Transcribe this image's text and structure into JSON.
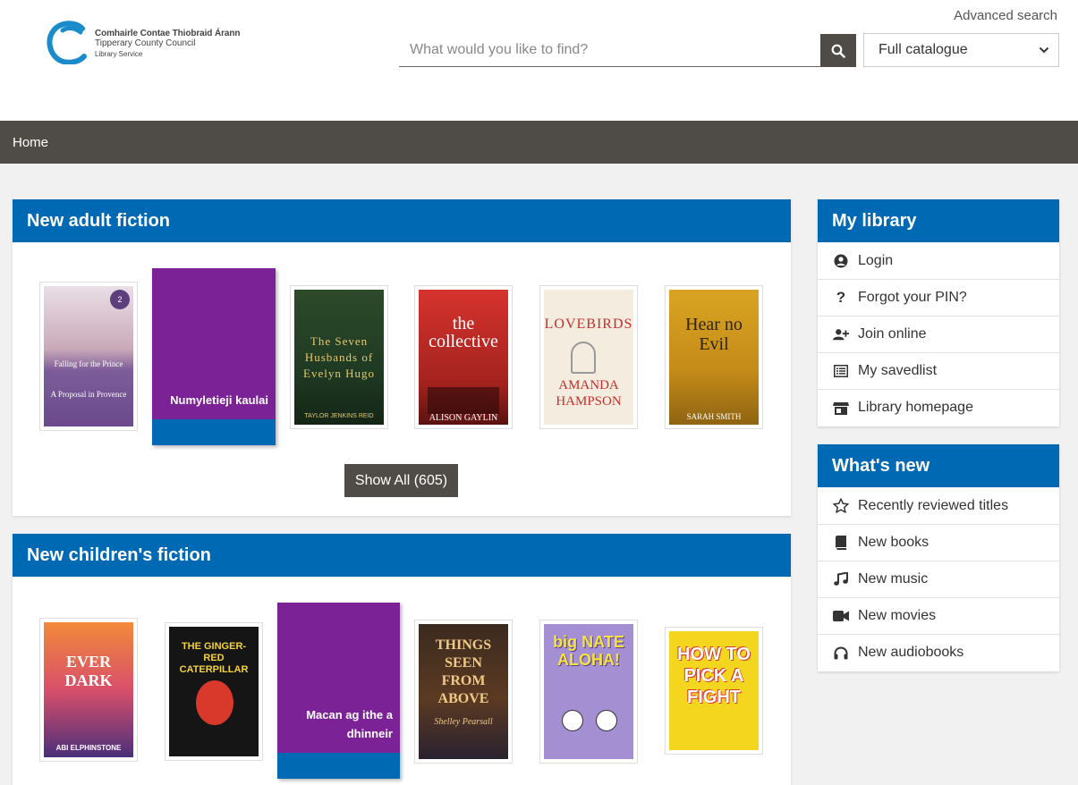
{
  "header": {
    "logo_line1": "Comhairle Contae Thiobraid Árann",
    "logo_line2": "Tipperary County Council",
    "logo_line3": "Library Service",
    "advanced_search": "Advanced search",
    "search_placeholder": "What would you like to find?",
    "catalogue_selected": "Full catalogue"
  },
  "nav": {
    "home": "Home"
  },
  "adult": {
    "title": "New adult fiction",
    "books": [
      {
        "cover_top": "Falling for the Prince",
        "cover_bottom": "A Proposal in Provence"
      },
      {
        "placeholder_title": "Numyletieji kaulai"
      },
      {
        "cover_top": "The Seven Husbands of Evelyn Hugo",
        "cover_bottom": "TAYLOR JENKINS REID"
      },
      {
        "cover_top": "the collective",
        "cover_bottom": "ALISON GAYLIN"
      },
      {
        "cover_top": "LOVEBIRDS",
        "cover_bottom": "AMANDA HAMPSON"
      },
      {
        "cover_top": "Hear no Evil",
        "cover_bottom": "SARAH SMITH"
      }
    ],
    "show_all": "Show All (605)"
  },
  "children": {
    "title": "New children's fiction",
    "books": [
      {
        "cover_top": "EVER DARK",
        "cover_bottom": "ABI ELPHINSTONE"
      },
      {
        "cover_top": "THE GINGER-RED CATERPILLAR",
        "cover_bottom": ""
      },
      {
        "placeholder_title": "Macan ag ithe a dhinneir"
      },
      {
        "cover_top": "THINGS SEEN FROM ABOVE",
        "cover_bottom": "Shelley Pearsall"
      },
      {
        "cover_top": "big NATE ALOHA!",
        "cover_bottom": ""
      },
      {
        "cover_top": "HOW TO PICK A FIGHT",
        "cover_bottom": ""
      }
    ]
  },
  "my_library": {
    "title": "My library",
    "items": [
      {
        "label": "Login",
        "icon": "user-circle-icon"
      },
      {
        "label": "Forgot your PIN?",
        "icon": "question-icon"
      },
      {
        "label": "Join online",
        "icon": "user-plus-icon"
      },
      {
        "label": "My savedlist",
        "icon": "list-icon"
      },
      {
        "label": "Library homepage",
        "icon": "store-icon"
      }
    ]
  },
  "whats_new": {
    "title": "What's new",
    "items": [
      {
        "label": "Recently reviewed titles",
        "icon": "star-icon"
      },
      {
        "label": "New books",
        "icon": "book-icon"
      },
      {
        "label": "New music",
        "icon": "music-icon"
      },
      {
        "label": "New movies",
        "icon": "video-icon"
      },
      {
        "label": "New audiobooks",
        "icon": "headphones-icon"
      }
    ]
  },
  "colors": {
    "brand_blue": "#0069b4",
    "dark_bar": "#4f4c47",
    "placeholder_purple": "#7b2296"
  }
}
